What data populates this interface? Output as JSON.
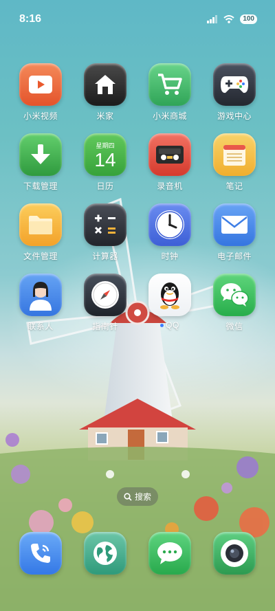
{
  "status_bar": {
    "time": "8:16",
    "battery": "100"
  },
  "apps": [
    {
      "label": "小米视频",
      "icon": "play-video-icon",
      "bg": "#ee6a3c"
    },
    {
      "label": "米家",
      "icon": "home-icon",
      "bg": "#2b2b2b"
    },
    {
      "label": "小米商城",
      "icon": "shopping-cart-icon",
      "bg": "#3cb362"
    },
    {
      "label": "游戏中心",
      "icon": "gamepad-icon",
      "bg": "#2f3540"
    },
    {
      "label": "下载管理",
      "icon": "download-arrow-icon",
      "bg": "#3daa4c"
    },
    {
      "label": "日历",
      "icon": "calendar-icon",
      "bg": "#45b045"
    },
    {
      "label": "录音机",
      "icon": "recorder-icon",
      "bg": "#e94b3c"
    },
    {
      "label": "笔记",
      "icon": "notes-icon",
      "bg": "#f3c24a"
    },
    {
      "label": "文件管理",
      "icon": "folder-icon",
      "bg": "#f4b235"
    },
    {
      "label": "计算器",
      "icon": "calculator-icon",
      "bg": "#2e3138"
    },
    {
      "label": "时钟",
      "icon": "clock-icon",
      "bg": "#4a6de0"
    },
    {
      "label": "电子邮件",
      "icon": "mail-icon",
      "bg": "#3f7fe6"
    },
    {
      "label": "联系人",
      "icon": "contact-person-icon",
      "bg": "#3d7fe4"
    },
    {
      "label": "指南针",
      "icon": "compass-icon",
      "bg": "#2b2f38"
    },
    {
      "label": "QQ",
      "icon": "qq-penguin-icon",
      "bg": "#ffffff"
    },
    {
      "label": "微信",
      "icon": "wechat-icon",
      "bg": "#35c15a"
    }
  ],
  "calendar": {
    "weekday": "星期四",
    "day": "14"
  },
  "search": {
    "label": "搜索"
  },
  "dock": [
    {
      "icon": "phone-icon",
      "bg": "#3f8ef0"
    },
    {
      "icon": "browser-globe-icon",
      "bg": "#3fa889"
    },
    {
      "icon": "messages-icon",
      "bg": "#33b860"
    },
    {
      "icon": "camera-icon",
      "bg": "#3aa55e"
    }
  ]
}
